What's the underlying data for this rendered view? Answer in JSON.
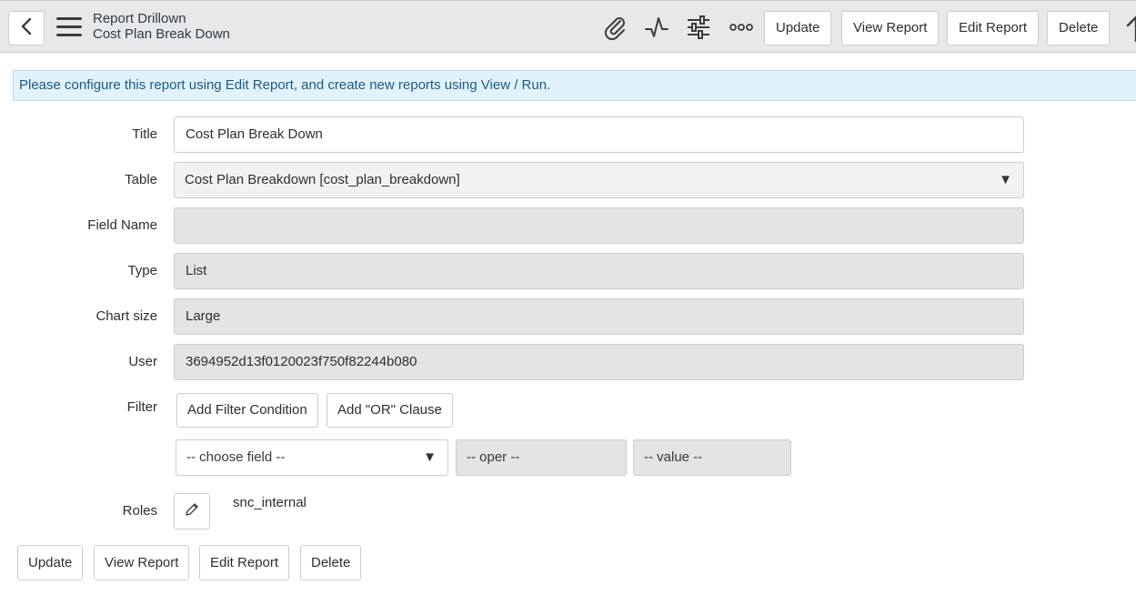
{
  "header": {
    "title": "Report Drillown",
    "subtitle": "Cost Plan Break Down",
    "icons": [
      "back-icon",
      "menu-icon",
      "attachment-icon",
      "activity-icon",
      "settings-icon",
      "more-options-icon",
      "up-arrow-icon"
    ],
    "buttons": {
      "update": "Update",
      "view_report": "View Report",
      "edit_report": "Edit Report",
      "delete": "Delete"
    }
  },
  "banner": {
    "message": "Please configure this report using Edit Report, and create new reports using View / Run."
  },
  "form": {
    "title": {
      "label": "Title",
      "value": "Cost Plan Break Down"
    },
    "table": {
      "label": "Table",
      "value": "Cost Plan Breakdown [cost_plan_breakdown]"
    },
    "field_name": {
      "label": "Field Name",
      "value": ""
    },
    "type": {
      "label": "Type",
      "value": "List"
    },
    "chart_size": {
      "label": "Chart size",
      "value": "Large"
    },
    "user": {
      "label": "User",
      "value": "3694952d13f0120023f750f82244b080"
    },
    "filter": {
      "label": "Filter",
      "add_condition": "Add Filter Condition",
      "add_or": "Add \"OR\" Clause",
      "choose_field": "-- choose field --",
      "oper": "-- oper --",
      "value": "-- value --"
    },
    "roles": {
      "label": "Roles",
      "value": "snc_internal"
    }
  },
  "footer": {
    "update": "Update",
    "view_report": "View Report",
    "edit_report": "Edit Report",
    "delete": "Delete"
  },
  "colors": {
    "header_bg": "#e6e8ea",
    "banner_bg": "#e2f2fa",
    "banner_text": "#1a5a8a",
    "readonly_bg": "#e4e4e4"
  }
}
